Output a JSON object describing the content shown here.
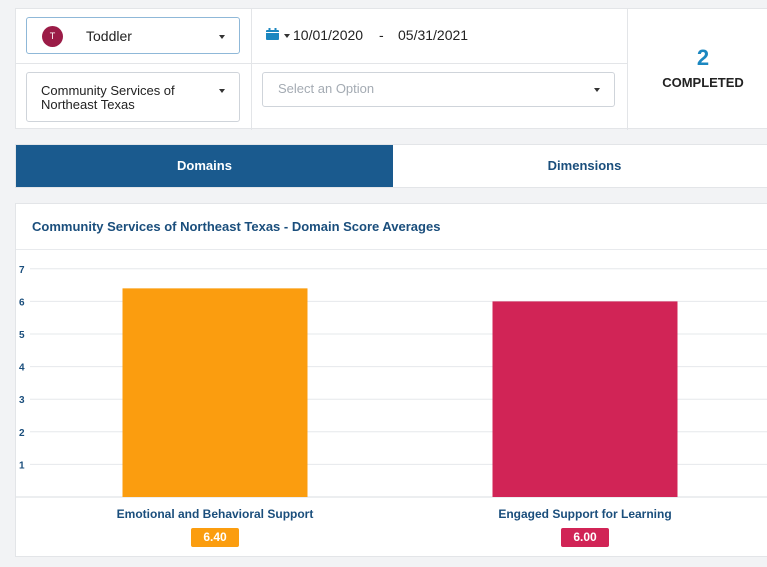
{
  "filters": {
    "level": {
      "avatar_letter": "T",
      "label": "Toddler",
      "avatar_color": "#9b1c47"
    },
    "program": {
      "label": "Community Services of Northeast Texas"
    },
    "date_range": {
      "start": "10/01/2020",
      "separator": "-",
      "end": "05/31/2021",
      "icon": "calendar-icon"
    },
    "option": {
      "placeholder": "Select an Option"
    }
  },
  "summary": {
    "count": "2",
    "label": "COMPLETED"
  },
  "tabs": [
    {
      "label": "Domains",
      "active": true
    },
    {
      "label": "Dimensions",
      "active": false
    }
  ],
  "colors": {
    "accent": "#1a5a8e",
    "series_1": "#fb9d0f",
    "series_2": "#d12456",
    "count": "#1b87c0"
  },
  "chart_data": {
    "type": "bar",
    "title": "Community Services of Northeast Texas - Domain Score Averages",
    "categories": [
      "Emotional and Behavioral Support",
      "Engaged Support for Learning"
    ],
    "values": [
      6.4,
      6.0
    ],
    "value_labels": [
      "6.40",
      "6.00"
    ],
    "colors": [
      "#fb9d0f",
      "#d12456"
    ],
    "y_ticks": [
      1,
      2,
      3,
      4,
      5,
      6,
      7
    ],
    "ylim": [
      0,
      7
    ],
    "grid": true
  }
}
